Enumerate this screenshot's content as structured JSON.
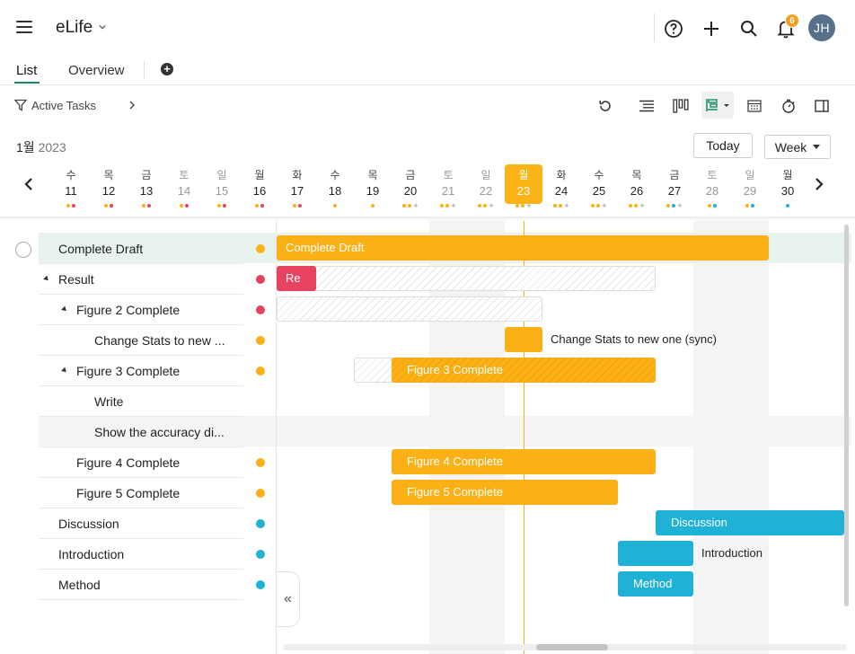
{
  "header": {
    "project_title": "eLife",
    "notification_count": "6",
    "avatar_initials": "JH"
  },
  "tabs": {
    "list": "List",
    "overview": "Overview",
    "add": "+"
  },
  "toolbar": {
    "filter_label": "Active Tasks",
    "today_label": "Today",
    "view_label": "Week"
  },
  "calendar": {
    "month": "1월",
    "year": "2023",
    "days": [
      {
        "name": "수",
        "num": "11"
      },
      {
        "name": "목",
        "num": "12"
      },
      {
        "name": "금",
        "num": "13"
      },
      {
        "name": "토",
        "num": "14"
      },
      {
        "name": "일",
        "num": "15"
      },
      {
        "name": "월",
        "num": "16"
      },
      {
        "name": "화",
        "num": "17"
      },
      {
        "name": "수",
        "num": "18"
      },
      {
        "name": "목",
        "num": "19"
      },
      {
        "name": "금",
        "num": "20"
      },
      {
        "name": "토",
        "num": "21"
      },
      {
        "name": "일",
        "num": "22"
      },
      {
        "name": "월",
        "num": "23"
      },
      {
        "name": "화",
        "num": "24"
      },
      {
        "name": "수",
        "num": "25"
      },
      {
        "name": "목",
        "num": "26"
      },
      {
        "name": "금",
        "num": "27"
      },
      {
        "name": "토",
        "num": "28"
      },
      {
        "name": "일",
        "num": "29"
      },
      {
        "name": "월",
        "num": "30"
      }
    ],
    "today": "23"
  },
  "tasks": [
    {
      "name": "Complete Draft",
      "status_color": "#fbb016"
    },
    {
      "name": "Result",
      "status_color": "#e84261"
    },
    {
      "name": "Figure 2 Complete",
      "status_color": "#e84261"
    },
    {
      "name": "Change Stats to new ...",
      "status_color": "#fbb016"
    },
    {
      "name": "Figure 3 Complete",
      "status_color": "#fbb016"
    },
    {
      "name": "Write",
      "status_color": ""
    },
    {
      "name": "Show the accuracy di...",
      "status_color": ""
    },
    {
      "name": "Figure 4 Complete",
      "status_color": "#fbb016"
    },
    {
      "name": "Figure 5 Complete",
      "status_color": "#fbb016"
    },
    {
      "name": "Discussion",
      "status_color": "#1fb1d6"
    },
    {
      "name": "Introduction",
      "status_color": "#1fb1d6"
    },
    {
      "name": "Method",
      "status_color": "#1fb1d6"
    }
  ],
  "bars": {
    "complete_draft": "Complete Draft",
    "result": "Re",
    "change_stats": "Change Stats to new one (sync)",
    "figure3": "Figure 3 Complete",
    "figure4": "Figure 4 Complete",
    "figure5": "Figure 5 Complete",
    "discussion": "Discussion",
    "introduction": "Introduction",
    "method": "Method"
  },
  "colors": {
    "orange": "#fbb016",
    "blue": "#1fb1d6",
    "red": "#e84261",
    "accent_green": "#1a8a5e"
  }
}
